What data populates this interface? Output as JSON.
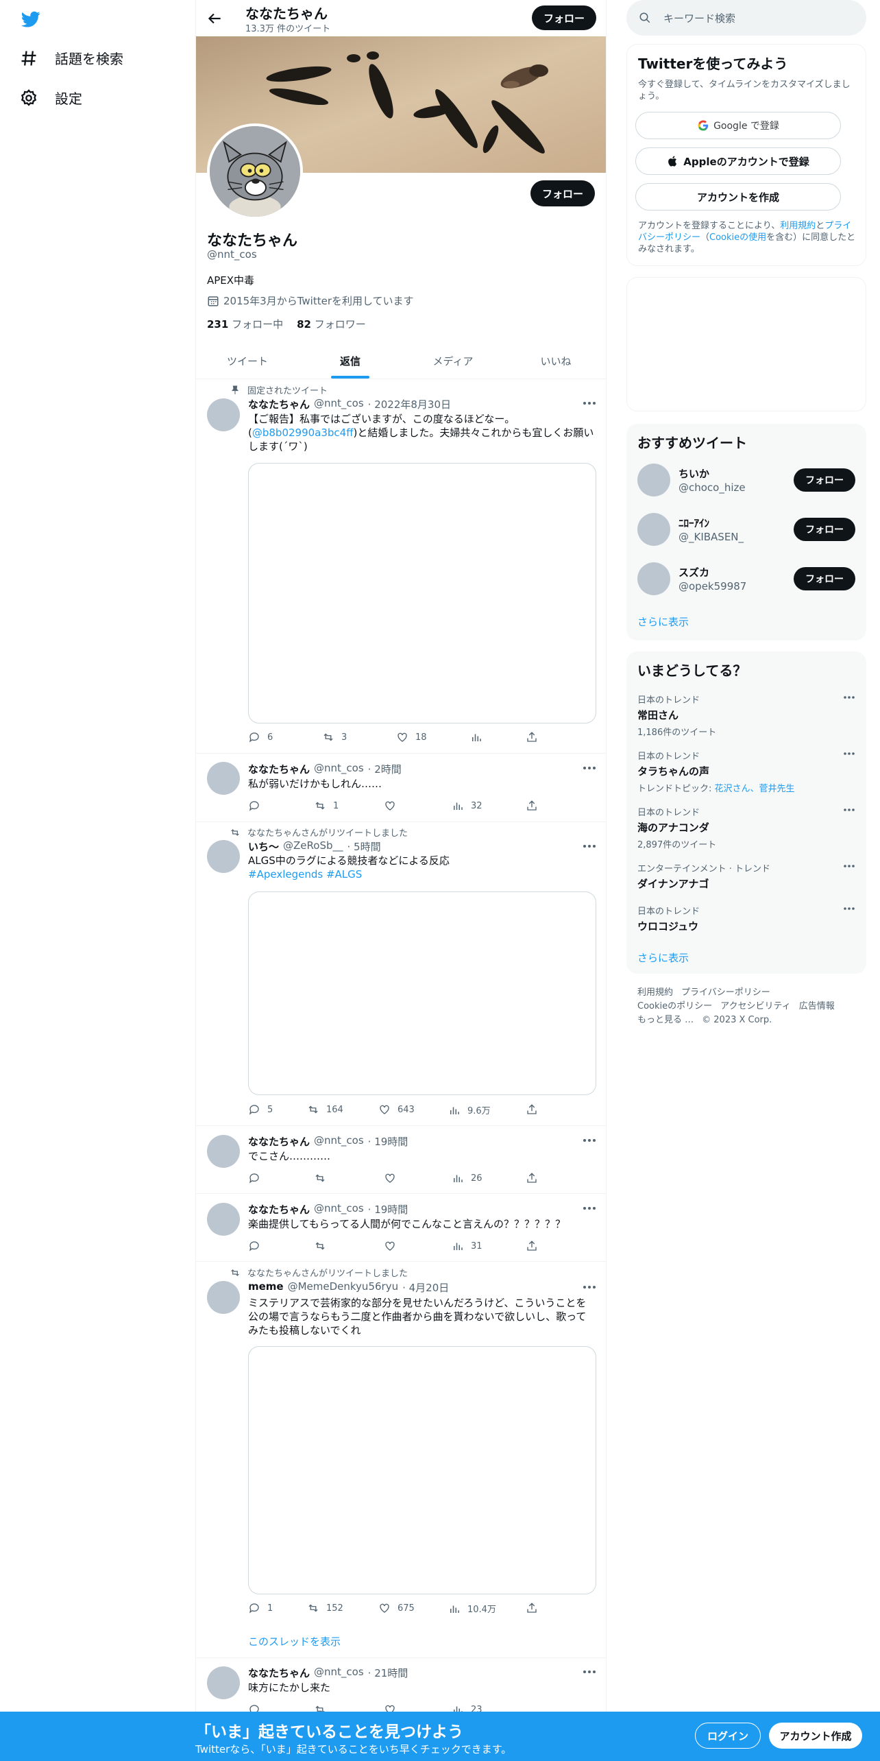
{
  "nav": {
    "explore_label": "話題を検索",
    "settings_label": "設定"
  },
  "profile": {
    "header_name": "ななたちゃん",
    "header_count": "13.3万 件のツイート",
    "follow_label": "フォロー",
    "banner_text": "ブラハ",
    "name": "ななたちゃん",
    "handle": "@nnt_cos",
    "bio": "APEX中毒",
    "joined": "2015年3月からTwitterを利用しています",
    "following_count": "231",
    "following_label": "フォロー中",
    "followers_count": "82",
    "followers_label": "フォロワー"
  },
  "tabs": [
    "ツイート",
    "返信",
    "メディア",
    "いいね"
  ],
  "active_tab": "返信",
  "tweets": [
    {
      "context": "固定されたツイート",
      "name": "ななたちゃん",
      "handle": "@nnt_cos",
      "time": "· 2022年8月30日",
      "text_1": "【ご報告】私事ではございますが、この度なるほどなー。(",
      "mention": "@b8b02990a3bc4ff",
      "text_2": ")と結婚しました。夫婦共々これからも宜しくお願いします(´ワ`)",
      "replies": "6",
      "retweets": "3",
      "likes": "18",
      "views": ""
    },
    {
      "name": "ななたちゃん",
      "handle": "@nnt_cos",
      "time": "· 2時間",
      "text": "私が弱いだけかもしれん……",
      "replies": "",
      "retweets": "1",
      "likes": "",
      "views": "32"
    },
    {
      "context": "ななたちゃんさんがリツイートしました",
      "name": "いち～",
      "handle": "@ZeRoSb__",
      "time": "· 5時間",
      "text": "ALGS中のラグによる競技者などによる反応",
      "hashtags": "#Apexlegends #ALGS",
      "replies": "5",
      "retweets": "164",
      "likes": "643",
      "views": "9.6万"
    },
    {
      "name": "ななたちゃん",
      "handle": "@nnt_cos",
      "time": "· 19時間",
      "text": "でこさん…………",
      "replies": "",
      "retweets": "",
      "likes": "",
      "views": "26"
    },
    {
      "name": "ななたちゃん",
      "handle": "@nnt_cos",
      "time": "· 19時間",
      "text": "楽曲提供してもらってる人間が何でこんなこと言えんの？？？？？？",
      "replies": "",
      "retweets": "",
      "likes": "",
      "views": "31"
    },
    {
      "context": "ななたちゃんさんがリツイートしました",
      "name": "meme",
      "handle": "@MemeDenkyu56ryu",
      "time": "· 4月20日",
      "text": "ミステリアスで芸術家的な部分を見せたいんだろうけど、こういうことを公の場で言うならもう二度と作曲者から曲を貰わないで欲しいし、歌ってみたも投稿しないでくれ",
      "replies": "1",
      "retweets": "152",
      "likes": "675",
      "views": "10.4万",
      "thread_label": "このスレッドを表示"
    },
    {
      "name": "ななたちゃん",
      "handle": "@nnt_cos",
      "time": "· 21時間",
      "text": "味方にたかし来た",
      "views": "23"
    }
  ],
  "search": {
    "placeholder": "キーワード検索"
  },
  "signup": {
    "title": "Twitterを使ってみよう",
    "subtitle": "今すぐ登録して、タイムラインをカスタマイズしましょう。",
    "google_label": "Google で登録",
    "apple_label": "Appleのアカウントで登録",
    "create_label": "アカウントを作成",
    "terms_1": "アカウントを登録することにより、",
    "terms_link_1": "利用規約",
    "terms_2": "と",
    "terms_link_2": "プライバシーポリシー",
    "terms_3": "（",
    "terms_link_3": "Cookieの使用",
    "terms_4": "を含む）に同意したとみなされます。"
  },
  "recommended": {
    "title": "おすすめツイート",
    "users": [
      {
        "name": "ちいか",
        "handle": "@choco_hize"
      },
      {
        "name": "ﾆﾛｰｱｲﾝ",
        "handle": "@_KIBASEN_"
      },
      {
        "name": "スズカ",
        "handle": "@opek59987"
      }
    ],
    "follow_label": "フォロー",
    "show_more": "さらに表示"
  },
  "trends": {
    "title": "いまどうしてる？",
    "items": [
      {
        "label": "日本のトレンド",
        "title": "常田さん",
        "sub": "1,186件のツイート"
      },
      {
        "label": "日本のトレンド",
        "title": "タラちゃんの声",
        "sub_prefix": "トレンドトピック: ",
        "sub_link": "花沢さん、菅井先生"
      },
      {
        "label": "日本のトレンド",
        "title": "海のアナコンダ",
        "sub": "2,897件のツイート"
      },
      {
        "label": "エンターテインメント · トレンド",
        "title": "ダイナンアナゴ"
      },
      {
        "label": "日本のトレンド",
        "title": "ウロコジュウ"
      }
    ],
    "show_more": "さらに表示"
  },
  "footer": {
    "links": [
      "利用規約",
      "プライバシーポリシー",
      "Cookieのポリシー",
      "アクセシビリティ",
      "広告情報",
      "もっと見る …",
      "© 2023 X Corp."
    ]
  },
  "bottom_bar": {
    "title": "「いま」起きていることを見つけよう",
    "subtitle": "Twitterなら、「いま」起きていることをいち早くチェックできます。",
    "login_label": "ログイン",
    "create_label": "アカウント作成"
  },
  "colors": {
    "accent": "#1d9bf0",
    "text": "#0f1419",
    "muted": "#536471"
  }
}
